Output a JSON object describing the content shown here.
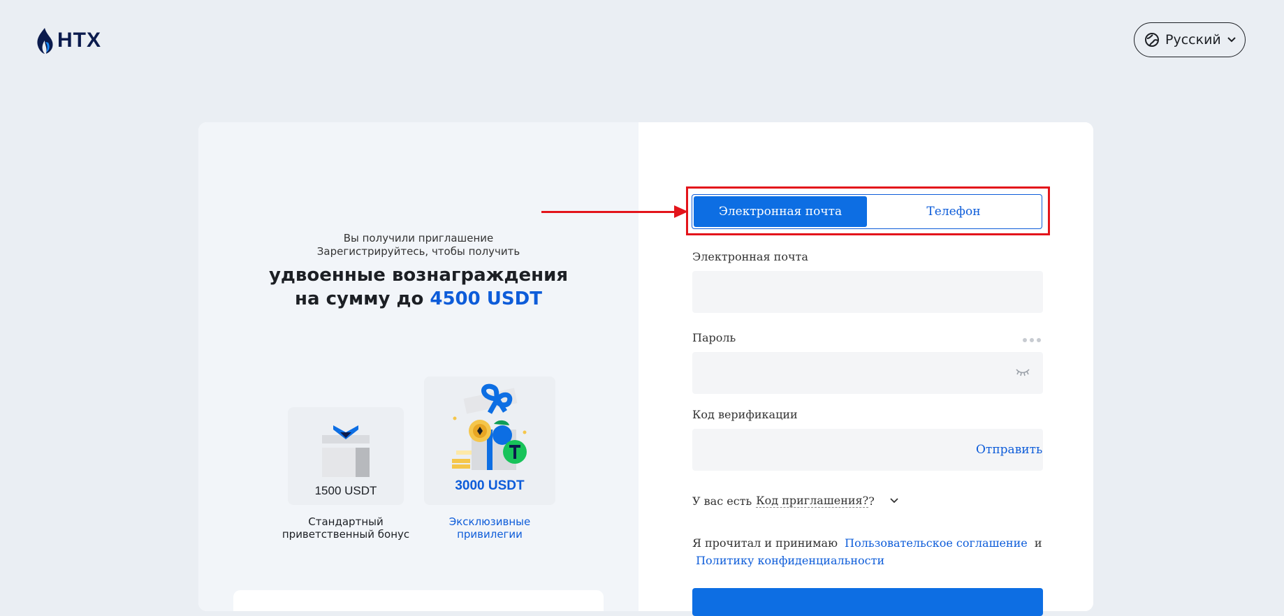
{
  "header": {
    "logo_text": "HTX",
    "language": "Русский"
  },
  "promo": {
    "line1": "Вы получили приглашение",
    "line2": "Зарегистрируйтесь, чтобы получить",
    "headline1": "удвоенные вознаграждения",
    "headline2_prefix": "на сумму до ",
    "headline2_accent": "4500 USDT"
  },
  "bonuses": [
    {
      "value": "1500 USDT",
      "caption_line1": "Стандартный",
      "caption_line2": "приветственный бонус"
    },
    {
      "value": "3000 USDT",
      "caption_line1": "Эксклюзивные",
      "caption_line2": "привилегии"
    }
  ],
  "form": {
    "tabs": [
      {
        "label": "Электронная почта",
        "active": true
      },
      {
        "label": "Телефон",
        "active": false
      }
    ],
    "email_label": "Электронная почта",
    "password_label": "Пароль",
    "code_label": "Код верификации",
    "send_label": "Отправить",
    "invite_prefix": "У вас есть",
    "invite_link": "Код приглашения?",
    "invite_suffix": "?",
    "agree_text": "Я прочитал и принимаю",
    "agree_link1": "Пользовательское соглашение",
    "agree_and": "и",
    "agree_link2": "Политику конфиденциальности"
  },
  "colors": {
    "accent": "#0d6ee3",
    "highlight": "#e3141b",
    "page_bg": "#eaeef3"
  }
}
